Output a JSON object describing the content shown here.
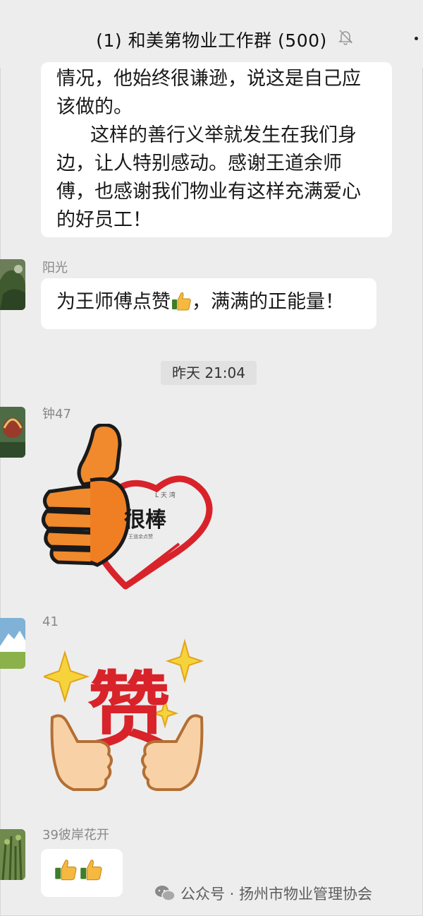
{
  "header": {
    "title": "(1) 和美第物业工作群 (500)",
    "mute_icon": "bell-muted-icon",
    "more_icon": "more-dots-icon"
  },
  "messages": [
    {
      "type": "text",
      "paragraphs": [
        "情况，他始终很谦逊，说这是自己应该做的。",
        "这样的善行义举就发生在我们身边，让人特别感动。感谢王道余师傅，也感谢我们物业有这样充满爱心的好员工！"
      ]
    },
    {
      "sender": "阳光",
      "type": "text",
      "text_before": "为王师傅点赞",
      "text_after": "，满满的正能量！"
    },
    {
      "type": "timestamp",
      "text": "昨天 21:04"
    },
    {
      "sender": "钟47",
      "type": "sticker",
      "sticker_text": "很棒",
      "logo_text": "L 天 湾",
      "tiny_caption": "王道余点赞"
    },
    {
      "sender": "41",
      "type": "sticker",
      "sticker_text": "赞"
    },
    {
      "sender": "39彼岸花开",
      "type": "emoji",
      "emoji": "thumbs-up-icon x2"
    }
  ],
  "watermark": {
    "text": "公众号 · 扬州市物业管理协会",
    "icon": "wechat-icon"
  },
  "colors": {
    "background": "#ededed",
    "bubble": "#ffffff",
    "heart_red": "#d8232a",
    "sticker_orange": "#f08a2c",
    "star_yellow": "#f7d33b"
  }
}
